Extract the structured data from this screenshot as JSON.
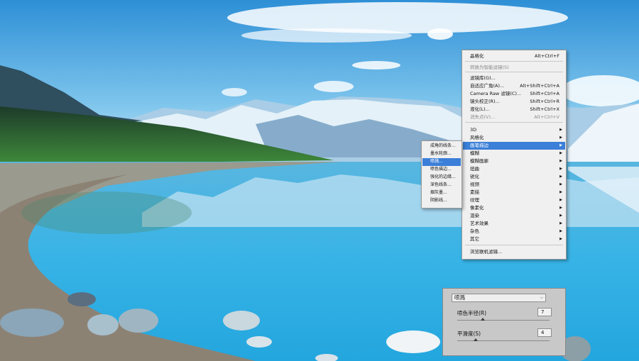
{
  "filter_menu": {
    "items": [
      {
        "label": "晶格化",
        "shortcut": "Alt+Ctrl+F"
      },
      {
        "label": "转换为智能滤镜(S)",
        "disabled": true
      },
      {
        "label": "滤镜库(G)..."
      },
      {
        "label": "自适应广角(A)...",
        "shortcut": "Alt+Shift+Ctrl+A"
      },
      {
        "label": "Camera Raw 滤镜(C)...",
        "shortcut": "Shift+Ctrl+A"
      },
      {
        "label": "镜头校正(R)...",
        "shortcut": "Shift+Ctrl+R"
      },
      {
        "label": "液化(L)...",
        "shortcut": "Shift+Ctrl+X"
      },
      {
        "label": "消失点(V)...",
        "shortcut": "Alt+Ctrl+V",
        "disabled": true
      },
      {
        "label": "3D",
        "submenu": true
      },
      {
        "label": "风格化",
        "submenu": true
      },
      {
        "label": "画笔描边",
        "submenu": true,
        "highlighted": true
      },
      {
        "label": "模糊",
        "submenu": true
      },
      {
        "label": "模糊画廊",
        "submenu": true
      },
      {
        "label": "扭曲",
        "submenu": true
      },
      {
        "label": "锐化",
        "submenu": true
      },
      {
        "label": "视频",
        "submenu": true
      },
      {
        "label": "素描",
        "submenu": true
      },
      {
        "label": "纹理",
        "submenu": true
      },
      {
        "label": "像素化",
        "submenu": true
      },
      {
        "label": "渲染",
        "submenu": true
      },
      {
        "label": "艺术效果",
        "submenu": true
      },
      {
        "label": "杂色",
        "submenu": true
      },
      {
        "label": "其它",
        "submenu": true
      },
      {
        "label": "浏览联机滤镜..."
      }
    ]
  },
  "brush_submenu": {
    "items": [
      {
        "label": "成角的线条..."
      },
      {
        "label": "墨水轮廓..."
      },
      {
        "label": "喷溅...",
        "highlighted": true
      },
      {
        "label": "喷色描边..."
      },
      {
        "label": "强化的边缘..."
      },
      {
        "label": "深色线条..."
      },
      {
        "label": "烟灰墨..."
      },
      {
        "label": "阴影线..."
      }
    ]
  },
  "settings_panel": {
    "filter_name": "喷溅",
    "params": [
      {
        "label": "喷色半径(R)",
        "value": "7",
        "fraction": 0.28
      },
      {
        "label": "平滑度(S)",
        "value": "4",
        "fraction": 0.2
      }
    ]
  },
  "colors": {
    "highlight": "#3b7fd8",
    "menu_bg": "#f0f0f0",
    "panel_bg": "#c8c8c8"
  }
}
